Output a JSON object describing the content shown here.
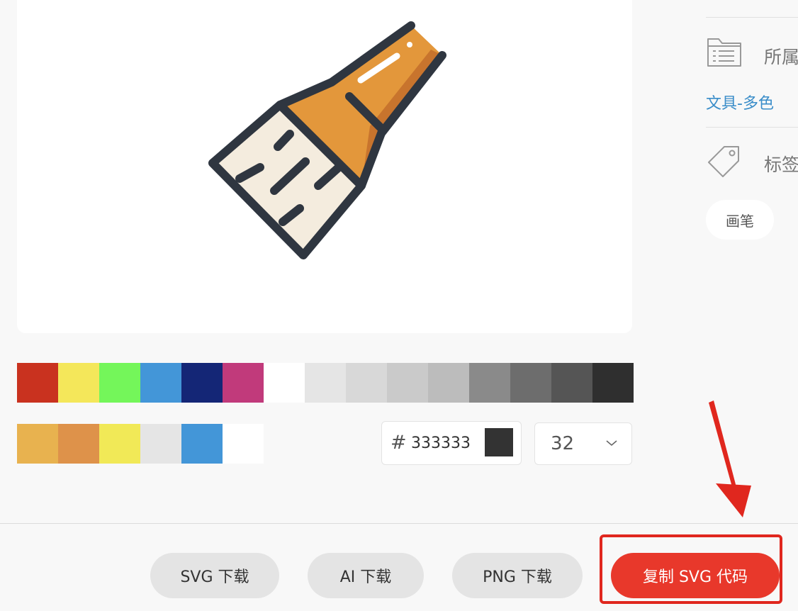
{
  "icon_name": "paintbrush-icon",
  "palette_primary": [
    "#c9321f",
    "#f4e75a",
    "#74f65a",
    "#4396d8",
    "#142676",
    "#c13a7b",
    "#ffffff",
    "#e5e5e5",
    "#d8d8d8",
    "#cacaca",
    "#bcbcbc",
    "#8a8a8a",
    "#6d6d6d",
    "#555555",
    "#2f2f2f"
  ],
  "palette_icon": [
    "#e8b24f",
    "#de924a",
    "#f1e957",
    "#e5e5e5",
    "#4396d8",
    "#ffffff"
  ],
  "color_input": {
    "hash": "#",
    "value": "333333",
    "swatch_color": "#333333"
  },
  "size_select": {
    "value": "32"
  },
  "buttons": {
    "svg_download": "SVG 下载",
    "ai_download": "AI 下载",
    "png_download": "PNG 下载",
    "copy_svg": "复制 SVG 代码"
  },
  "sidebar": {
    "category_label": "所属",
    "category_value": "文具-多色",
    "tags_label": "标签",
    "tags": [
      "画笔"
    ]
  },
  "colors": {
    "accent": "#e8382b",
    "link": "#3a8dc9",
    "annotation": "#e0271e"
  }
}
